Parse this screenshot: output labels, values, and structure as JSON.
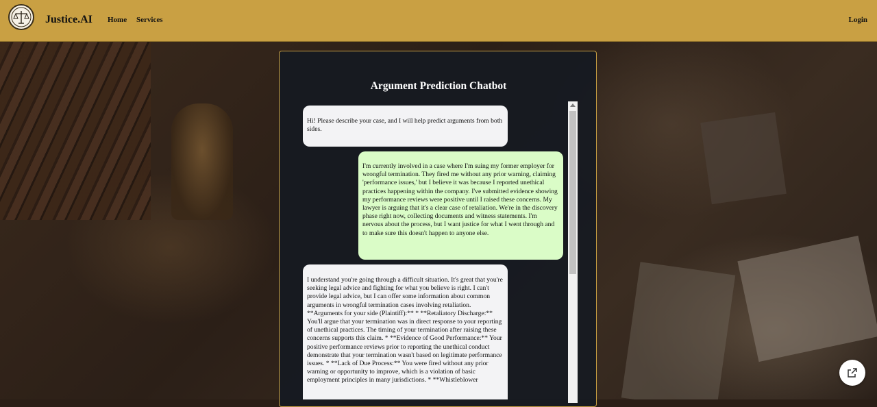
{
  "header": {
    "brand": "Justice.AI",
    "nav": {
      "home": "Home",
      "services": "Services"
    },
    "login": "Login",
    "logo_icon": "scales-of-justice-icon"
  },
  "chat": {
    "title": "Argument Prediction Chatbot",
    "messages": [
      {
        "role": "bot",
        "text": "Hi! Please describe your case, and I will help predict arguments from both sides."
      },
      {
        "role": "user",
        "text": "I'm currently involved in a case where I'm suing my former employer for wrongful termination. They fired me without any prior warning, claiming 'performance issues,' but I believe it was because I reported unethical practices happening within the company. I've submitted evidence showing my performance reviews were positive until I raised these concerns. My lawyer is arguing that it's a clear case of retaliation. We're in the discovery phase right now, collecting documents and witness statements. I'm nervous about the process, but I want justice for what I went through and to make sure this doesn't happen to anyone else."
      },
      {
        "role": "bot",
        "text": "I understand you're going through a difficult situation. It's great that you're seeking legal advice and fighting for what you believe is right. I can't provide legal advice, but I can offer some information about common arguments in wrongful termination cases involving retaliation. **Arguments for your side (Plaintiff):** * **Retaliatory Discharge:** You'll argue that your termination was in direct response to your reporting of unethical practices. The timing of your termination after raising these concerns supports this claim. * **Evidence of Good Performance:** Your positive performance reviews prior to reporting the unethical conduct demonstrate that your termination wasn't based on legitimate performance issues. * **Lack of Due Process:** You were fired without any prior warning or opportunity to improve, which is a violation of basic employment principles in many jurisdictions. * **Whistleblower"
      }
    ]
  },
  "colors": {
    "header_bg": "#c9a043",
    "panel_bg": "#161a21",
    "bot_bubble": "#f3f3f5",
    "user_bubble": "#dafcc7",
    "accent": "#c9a043"
  },
  "floating_button": {
    "icon": "external-link-icon"
  }
}
